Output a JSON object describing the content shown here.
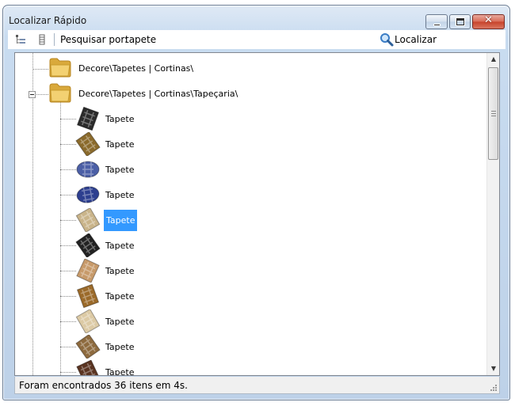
{
  "window": {
    "title": "Localizar Rápido",
    "controls": {
      "minimize_icon": "minimize-icon",
      "maximize_icon": "maximize-icon",
      "close_icon": "close-icon",
      "close_glyph": "✕"
    }
  },
  "toolbar": {
    "icons": [
      "tree-view-icon",
      "column-view-icon"
    ],
    "search_label": "Pesquisar por:",
    "search_value": "tapete",
    "find_label": "Localizar",
    "find_icon": "magnifier-icon"
  },
  "tree": {
    "folders": [
      {
        "label": "Decore\\Tapetes | Cortinas\\",
        "icon": "folder-icon",
        "expanded": false
      },
      {
        "label": "Decore\\Tapetes | Cortinas\\Tapeçaria\\",
        "icon": "folder-icon",
        "expanded": true
      }
    ],
    "items": [
      {
        "label": "Tapete",
        "thumb": "zebra-rug-thumb",
        "color": "#2b2b2b"
      },
      {
        "label": "Tapete",
        "thumb": "leopard-rug-thumb",
        "color": "#8a6a2c"
      },
      {
        "label": "Tapete",
        "thumb": "blue-pattern-round-rug-thumb",
        "color": "#4b5fa6"
      },
      {
        "label": "Tapete",
        "thumb": "blue-round-rug-thumb",
        "color": "#2d3f8f"
      },
      {
        "label": "Tapete",
        "thumb": "beige-rug-thumb",
        "color": "#c9b48a",
        "selected": true
      },
      {
        "label": "Tapete",
        "thumb": "black-pattern-rug-thumb",
        "color": "#222222"
      },
      {
        "label": "Tapete",
        "thumb": "tan-rug-thumb",
        "color": "#c79a6a"
      },
      {
        "label": "Tapete",
        "thumb": "animal-hide-rug-thumb",
        "color": "#9b6a2a"
      },
      {
        "label": "Tapete",
        "thumb": "cream-rug-thumb",
        "color": "#dccaa5"
      },
      {
        "label": "Tapete",
        "thumb": "brown-rug-thumb",
        "color": "#8d6a3e"
      },
      {
        "label": "Tapete",
        "thumb": "dark-brown-rug-thumb",
        "color": "#5a3421"
      }
    ]
  },
  "status": {
    "text": "Foram encontrados 36 itens em 4s."
  }
}
